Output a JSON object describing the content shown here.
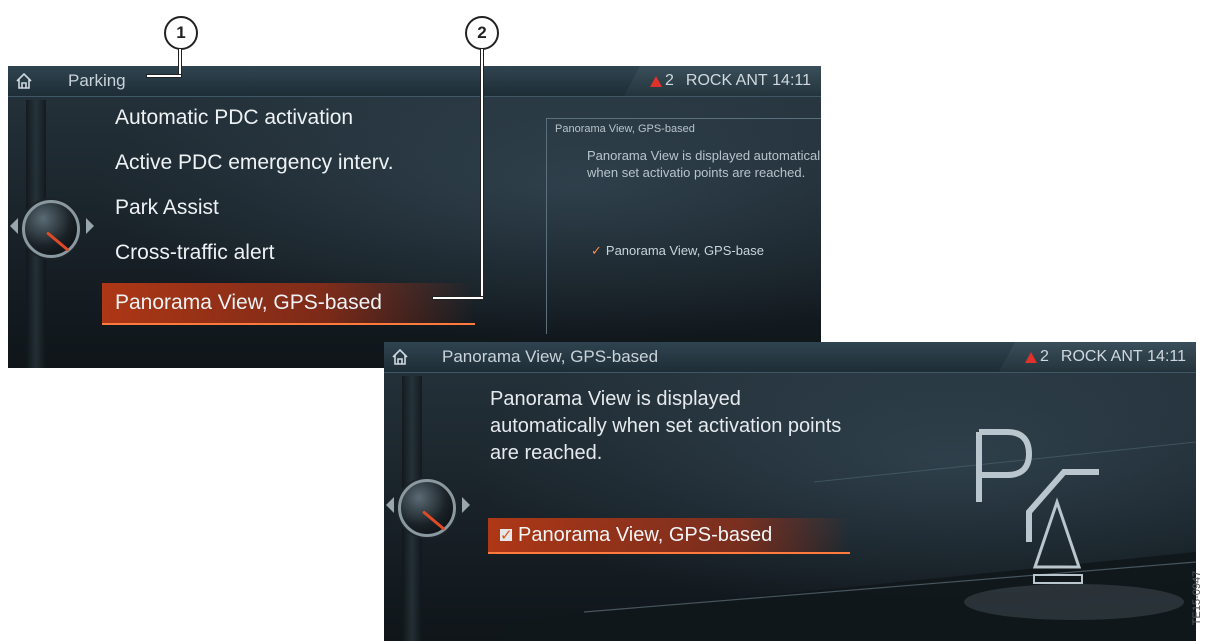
{
  "callouts": [
    "1",
    "2"
  ],
  "screen1": {
    "title": "Parking",
    "status": {
      "warning_count": "2",
      "source": "ROCK ANT",
      "time": "14:11"
    },
    "menu": [
      "Automatic PDC activation",
      "Active PDC emergency interv.",
      "Park Assist",
      "Cross-traffic alert",
      "Panorama View, GPS-based"
    ],
    "selected_index": 4,
    "preview": {
      "title": "Panorama View, GPS-based",
      "description": "Panorama View is displayed automatically when set activatio points are reached.",
      "checkbox_label": "Panorama View, GPS-base"
    }
  },
  "screen2": {
    "title": "Panorama View, GPS-based",
    "status": {
      "warning_count": "2",
      "source": "ROCK ANT",
      "time": "14:11"
    },
    "description": "Panorama View is displayed automatically when set activation points are reached.",
    "checkbox_label": "Panorama View, GPS-based",
    "checked": true
  },
  "image_code": "TE15-0947",
  "colors": {
    "accent": "#d4561f",
    "warning": "#e0312b",
    "background": "#1b252c"
  },
  "icons": {
    "home": "home-icon",
    "warning": "warning-icon",
    "check": "check-icon"
  }
}
